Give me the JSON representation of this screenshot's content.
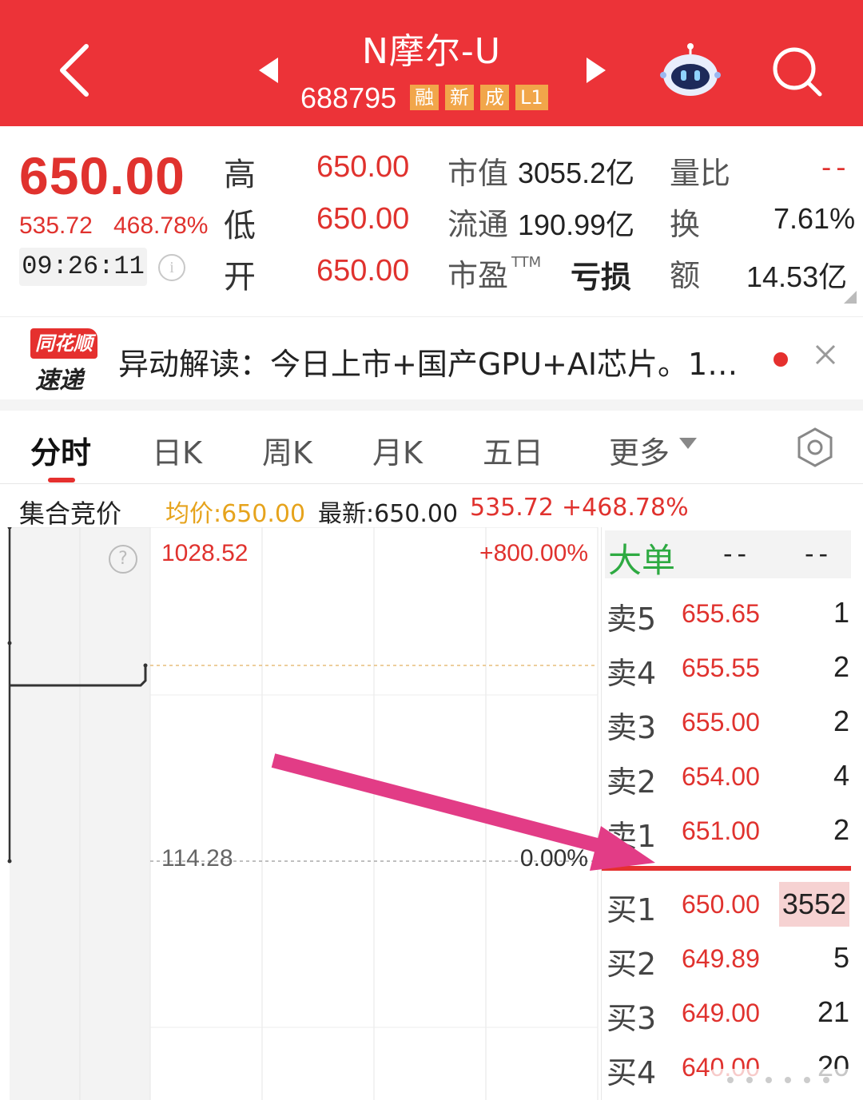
{
  "header": {
    "stock_name": "N摩尔-U",
    "stock_code": "688795",
    "tags": [
      "融",
      "新",
      "成",
      "L1"
    ],
    "icons": [
      "back-arrow-icon",
      "prev-stock-icon",
      "next-stock-icon",
      "robot-assistant-icon",
      "search-icon"
    ],
    "bg_color": "#ec3338"
  },
  "quote": {
    "last_price": "650.00",
    "change": "535.72",
    "change_pct": "468.78%",
    "time": "09:26:11",
    "high_label": "高",
    "high": "650.00",
    "low_label": "低",
    "low": "650.00",
    "open_label": "开",
    "open": "650.00",
    "mktcap_label": "市值",
    "mktcap": "3055.2亿",
    "float_label": "流通",
    "float": "190.99亿",
    "pe_label": "市盈",
    "pe_sup": "TTM",
    "pe": "亏损",
    "volratio_label": "量比",
    "volratio": "--",
    "turnover_label": "换",
    "turnover": "7.61%",
    "amount_label": "额",
    "amount": "14.53亿"
  },
  "news": {
    "logo_top": "同花顺",
    "logo_bottom": "速递",
    "text": "异动解读：今日上市+国产GPU+AI芯片。1…"
  },
  "tabs": [
    {
      "label": "分时",
      "active": true
    },
    {
      "label": "日K"
    },
    {
      "label": "周K"
    },
    {
      "label": "月K"
    },
    {
      "label": "五日"
    },
    {
      "label": "更多"
    }
  ],
  "chart_summary": {
    "label": "集合竞价",
    "avg": "均价:650.00",
    "latest": "最新:650.00",
    "change": "535.72",
    "change_pct": "+468.78%"
  },
  "chart": {
    "top_price": "1028.52",
    "top_pct": "+800.00%",
    "base_price": "114.28",
    "base_pct": "0.00%"
  },
  "orderbook": {
    "big_order_label": "大单",
    "big_order_v1": "--",
    "big_order_v2": "--",
    "asks": [
      {
        "level": "卖5",
        "price": "655.65",
        "vol": "1"
      },
      {
        "level": "卖4",
        "price": "655.55",
        "vol": "2"
      },
      {
        "level": "卖3",
        "price": "655.00",
        "vol": "2"
      },
      {
        "level": "卖2",
        "price": "654.00",
        "vol": "4"
      },
      {
        "level": "卖1",
        "price": "651.00",
        "vol": "2"
      }
    ],
    "bids": [
      {
        "level": "买1",
        "price": "650.00",
        "vol": "3552"
      },
      {
        "level": "买2",
        "price": "649.89",
        "vol": "5"
      },
      {
        "level": "买3",
        "price": "649.00",
        "vol": "21"
      },
      {
        "level": "买4",
        "price": "640.00",
        "vol": "20"
      }
    ]
  }
}
